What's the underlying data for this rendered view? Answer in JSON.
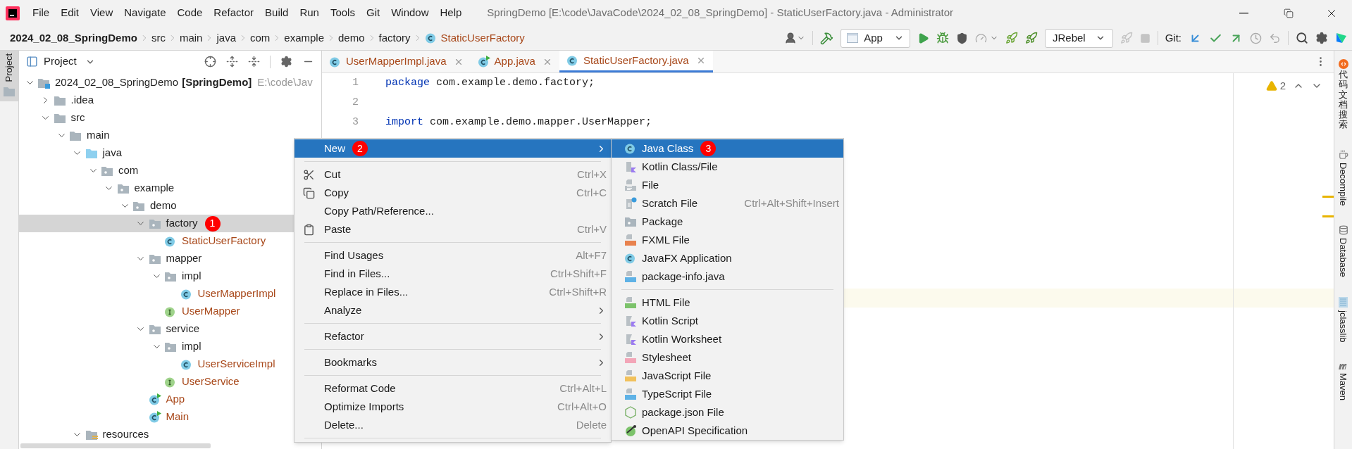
{
  "title_bar": {
    "menu": [
      "File",
      "Edit",
      "View",
      "Navigate",
      "Code",
      "Refactor",
      "Build",
      "Run",
      "Tools",
      "Git",
      "Window",
      "Help"
    ],
    "title": "SpringDemo [E:\\code\\JavaCode\\2024_02_08_SpringDemo] - StaticUserFactory.java - Administrator"
  },
  "breadcrumbs": [
    {
      "label": "2024_02_08_SpringDemo",
      "kind": "project"
    },
    {
      "label": "src",
      "kind": "folder"
    },
    {
      "label": "main",
      "kind": "folder"
    },
    {
      "label": "java",
      "kind": "folder"
    },
    {
      "label": "com",
      "kind": "folder"
    },
    {
      "label": "example",
      "kind": "folder"
    },
    {
      "label": "demo",
      "kind": "folder"
    },
    {
      "label": "factory",
      "kind": "folder"
    },
    {
      "label": "StaticUserFactory",
      "kind": "class"
    }
  ],
  "toolbar": {
    "run_config": "App",
    "jrebel_config": "JRebel",
    "git_label": "Git:"
  },
  "left_stripe": [
    {
      "label": "Project",
      "selected": true
    }
  ],
  "project_panel": {
    "title": "Project",
    "tree": [
      {
        "label": "2024_02_08_SpringDemo",
        "module": "[SpringDemo]",
        "path": "E:\\code\\Jav",
        "kind": "module",
        "expanded": true,
        "selected": false,
        "children": [
          {
            "label": ".idea",
            "kind": "folder",
            "expanded": false,
            "selected": false
          },
          {
            "label": "src",
            "kind": "folder",
            "expanded": true,
            "selected": false,
            "children": [
              {
                "label": "main",
                "kind": "folder",
                "expanded": true,
                "selected": false,
                "children": [
                  {
                    "label": "java",
                    "kind": "source-folder",
                    "expanded": true,
                    "selected": false,
                    "children": [
                      {
                        "label": "com",
                        "kind": "package",
                        "expanded": true,
                        "selected": false,
                        "children": [
                          {
                            "label": "example",
                            "kind": "package",
                            "expanded": true,
                            "selected": false,
                            "children": [
                              {
                                "label": "demo",
                                "kind": "package",
                                "expanded": true,
                                "selected": false,
                                "children": [
                                  {
                                    "label": "factory",
                                    "kind": "package",
                                    "expanded": true,
                                    "selected": true,
                                    "badge": "1",
                                    "children": [
                                      {
                                        "label": "StaticUserFactory",
                                        "kind": "class",
                                        "selected": false
                                      }
                                    ]
                                  },
                                  {
                                    "label": "mapper",
                                    "kind": "package",
                                    "expanded": true,
                                    "selected": false,
                                    "children": [
                                      {
                                        "label": "impl",
                                        "kind": "package",
                                        "expanded": true,
                                        "selected": false,
                                        "children": [
                                          {
                                            "label": "UserMapperImpl",
                                            "kind": "class",
                                            "selected": false
                                          }
                                        ]
                                      },
                                      {
                                        "label": "UserMapper",
                                        "kind": "interface",
                                        "selected": false
                                      }
                                    ]
                                  },
                                  {
                                    "label": "service",
                                    "kind": "package",
                                    "expanded": true,
                                    "selected": false,
                                    "children": [
                                      {
                                        "label": "impl",
                                        "kind": "package",
                                        "expanded": true,
                                        "selected": false,
                                        "children": [
                                          {
                                            "label": "UserServiceImpl",
                                            "kind": "class",
                                            "selected": false
                                          }
                                        ]
                                      },
                                      {
                                        "label": "UserService",
                                        "kind": "interface",
                                        "selected": false
                                      }
                                    ]
                                  },
                                  {
                                    "label": "App",
                                    "kind": "runnable",
                                    "selected": false
                                  },
                                  {
                                    "label": "Main",
                                    "kind": "runnable",
                                    "selected": false
                                  }
                                ]
                              }
                            ]
                          }
                        ]
                      }
                    ]
                  },
                  {
                    "label": "resources",
                    "kind": "resources-folder",
                    "expanded": true,
                    "selected": false
                  }
                ]
              }
            ]
          }
        ]
      }
    ]
  },
  "editor": {
    "tabs": [
      {
        "label": "UserMapperImpl.java",
        "kind": "class",
        "selected": false
      },
      {
        "label": "App.java",
        "kind": "runnable",
        "selected": false
      },
      {
        "label": "StaticUserFactory.java",
        "kind": "class",
        "selected": true
      }
    ],
    "lines": [
      {
        "number": "1",
        "keyword": "package",
        "code": "com.example.demo.factory;"
      },
      {
        "number": "2"
      },
      {
        "number": "3",
        "keyword": "import",
        "code": "com.example.demo.mapper.UserMapper;"
      }
    ],
    "warnings": "2"
  },
  "right_stripe": [
    {
      "label": "代码文档搜索",
      "kind": "cjk"
    },
    {
      "label": "Decompile",
      "kind": "latin"
    },
    {
      "label": "Database",
      "kind": "latin"
    },
    {
      "label": "jclasslib",
      "kind": "latin"
    },
    {
      "label": "Maven",
      "kind": "latin"
    }
  ],
  "context_menu": {
    "items": [
      {
        "kind": "item",
        "label": "New",
        "badge": "2",
        "submenu": true,
        "selected": true
      },
      {
        "kind": "separator"
      },
      {
        "kind": "item",
        "label": "Cut",
        "shortcut": "Ctrl+X",
        "selected": false
      },
      {
        "kind": "item",
        "label": "Copy",
        "shortcut": "Ctrl+C",
        "selected": false
      },
      {
        "kind": "item",
        "label": "Copy Path/Reference...",
        "selected": false
      },
      {
        "kind": "item",
        "label": "Paste",
        "shortcut": "Ctrl+V",
        "selected": false
      },
      {
        "kind": "separator"
      },
      {
        "kind": "item",
        "label": "Find Usages",
        "shortcut": "Alt+F7",
        "selected": false
      },
      {
        "kind": "item",
        "label": "Find in Files...",
        "shortcut": "Ctrl+Shift+F",
        "selected": false
      },
      {
        "kind": "item",
        "label": "Replace in Files...",
        "shortcut": "Ctrl+Shift+R",
        "selected": false
      },
      {
        "kind": "item",
        "label": "Analyze",
        "submenu": true,
        "selected": false
      },
      {
        "kind": "separator"
      },
      {
        "kind": "item",
        "label": "Refactor",
        "submenu": true,
        "selected": false
      },
      {
        "kind": "separator"
      },
      {
        "kind": "item",
        "label": "Bookmarks",
        "submenu": true,
        "selected": false
      },
      {
        "kind": "separator"
      },
      {
        "kind": "item",
        "label": "Reformat Code",
        "shortcut": "Ctrl+Alt+L",
        "selected": false
      },
      {
        "kind": "item",
        "label": "Optimize Imports",
        "shortcut": "Ctrl+Alt+O",
        "selected": false
      },
      {
        "kind": "item",
        "label": "Delete...",
        "shortcut": "Delete",
        "selected": false
      },
      {
        "kind": "separator"
      }
    ]
  },
  "submenu": {
    "items": [
      {
        "kind": "item",
        "label": "Java Class",
        "badge": "3",
        "selected": true
      },
      {
        "kind": "item",
        "label": "Kotlin Class/File",
        "selected": false
      },
      {
        "kind": "item",
        "label": "File",
        "selected": false
      },
      {
        "kind": "item",
        "label": "Scratch File",
        "shortcut": "Ctrl+Alt+Shift+Insert",
        "selected": false
      },
      {
        "kind": "item",
        "label": "Package",
        "selected": false
      },
      {
        "kind": "item",
        "label": "FXML File",
        "selected": false
      },
      {
        "kind": "item",
        "label": "JavaFX Application",
        "selected": false
      },
      {
        "kind": "item",
        "label": "package-info.java",
        "selected": false
      },
      {
        "kind": "separator"
      },
      {
        "kind": "item",
        "label": "HTML File",
        "selected": false
      },
      {
        "kind": "item",
        "label": "Kotlin Script",
        "selected": false
      },
      {
        "kind": "item",
        "label": "Kotlin Worksheet",
        "selected": false
      },
      {
        "kind": "item",
        "label": "Stylesheet",
        "selected": false
      },
      {
        "kind": "item",
        "label": "JavaScript File",
        "selected": false
      },
      {
        "kind": "item",
        "label": "TypeScript File",
        "selected": false
      },
      {
        "kind": "item",
        "label": "package.json File",
        "selected": false
      },
      {
        "kind": "item",
        "label": "OpenAPI Specification",
        "selected": false
      }
    ]
  }
}
